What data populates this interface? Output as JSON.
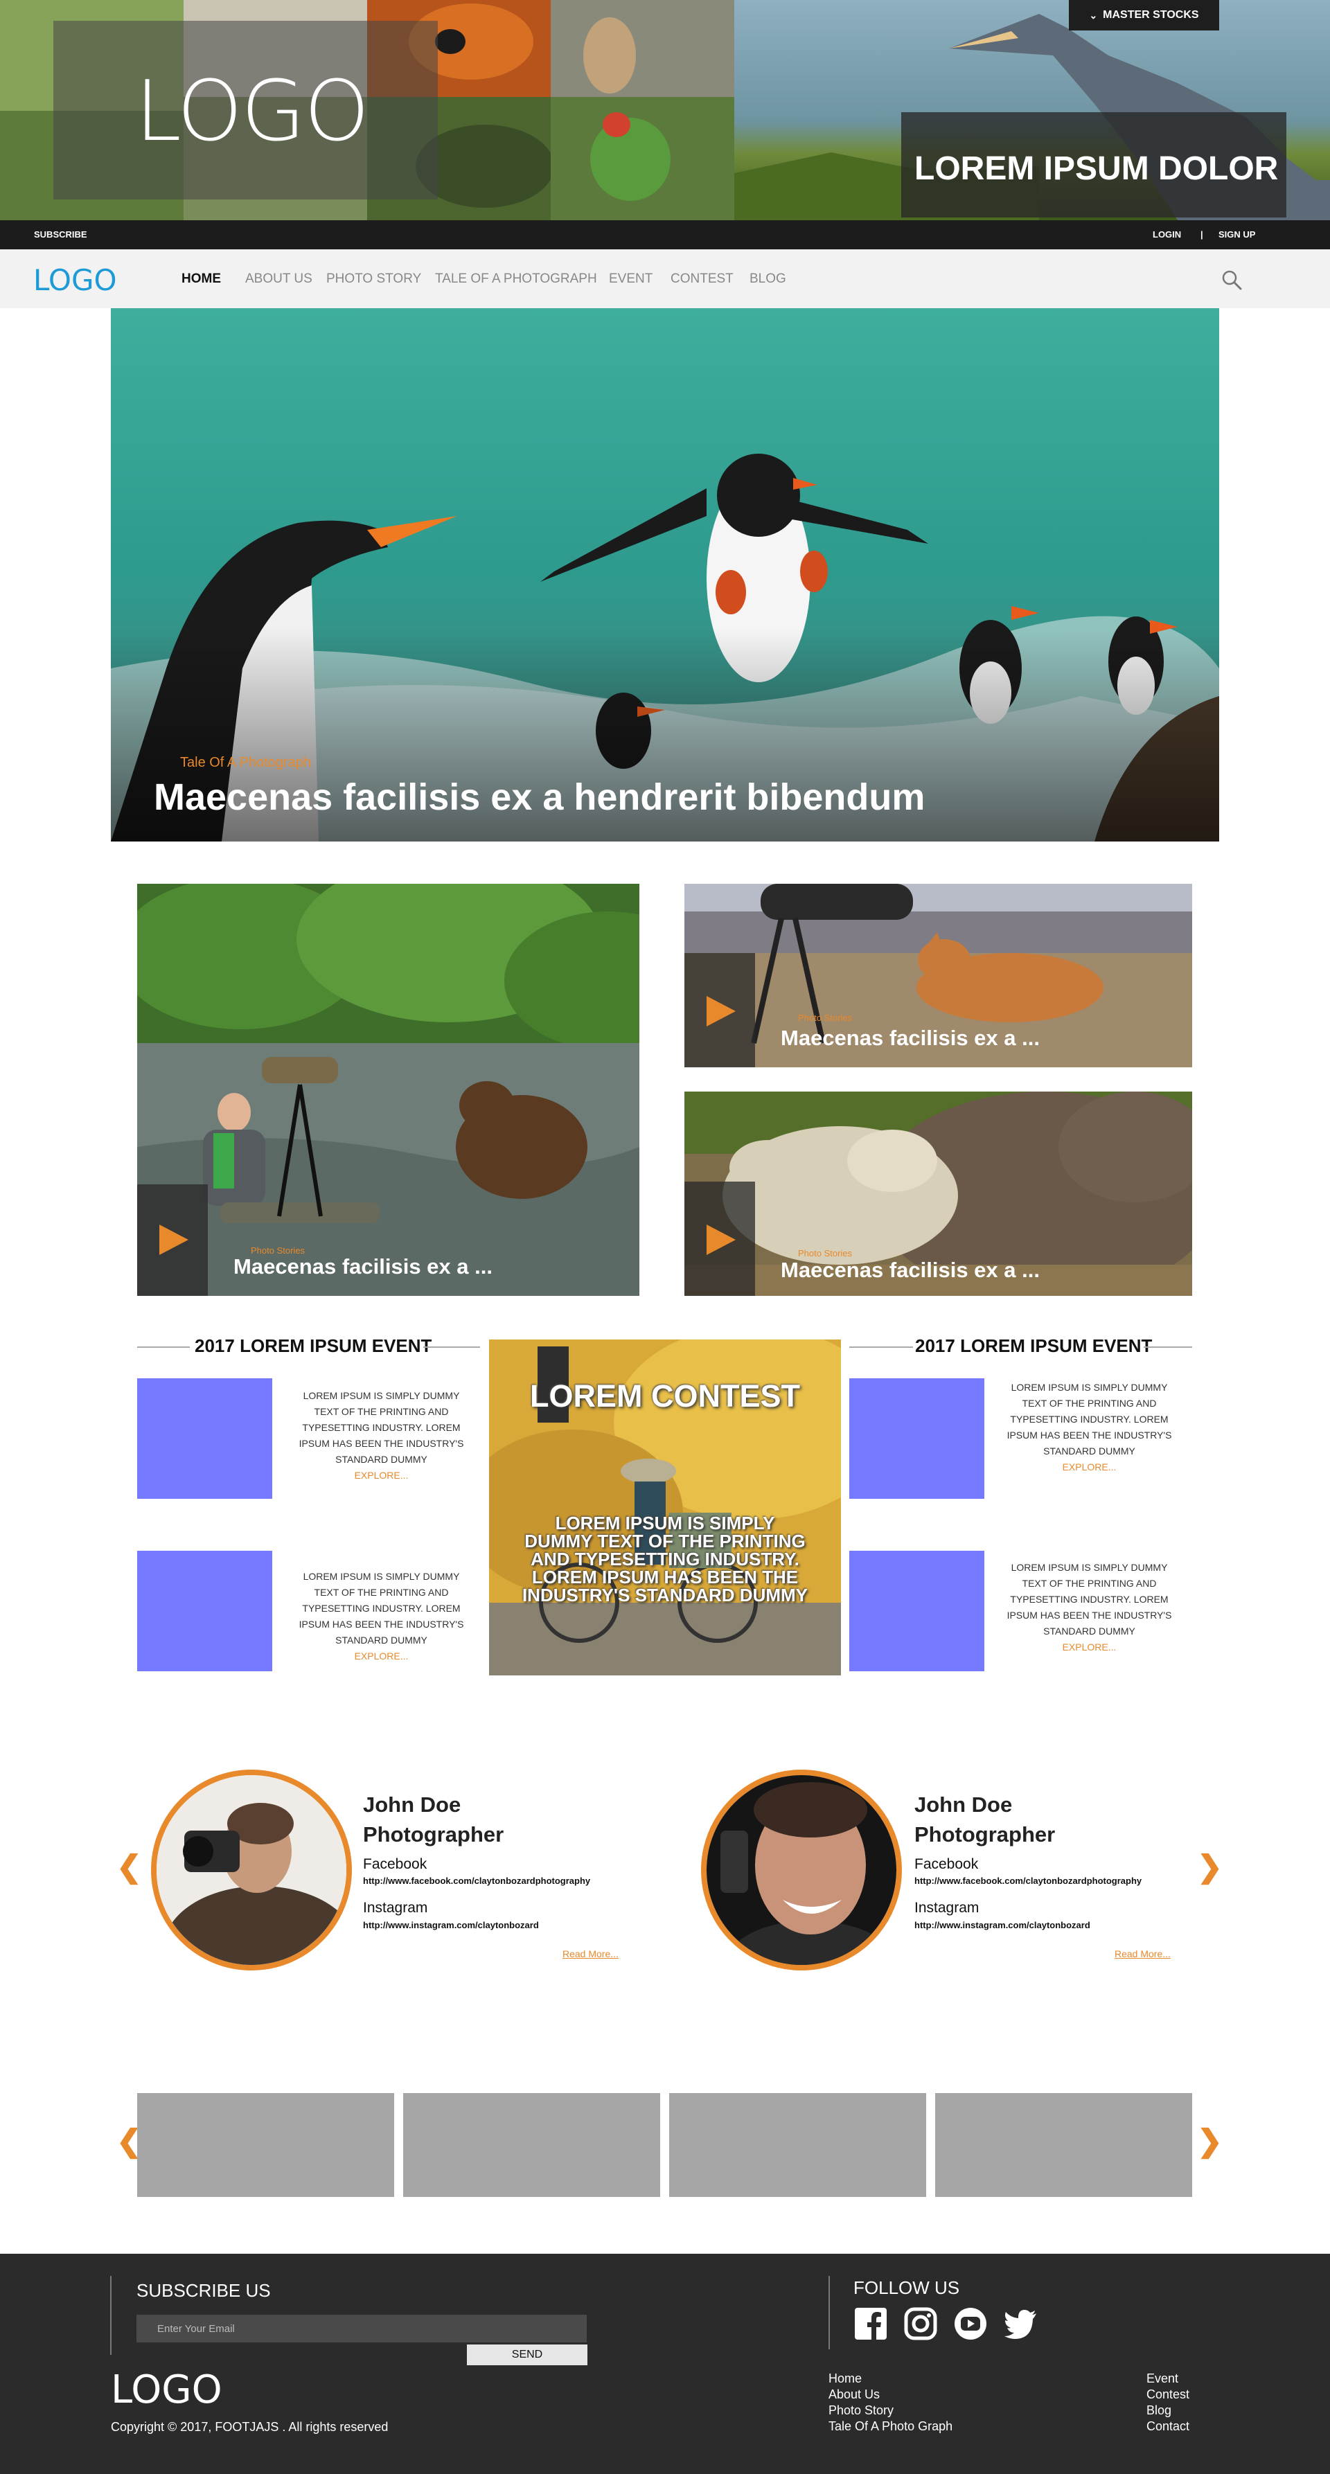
{
  "hero": {
    "logo": "LOGO",
    "master_stocks": "MASTER STOCKS",
    "tagline": "LOREM IPSUM DOLOR"
  },
  "topbar": {
    "subscribe": "SUBSCRIBE",
    "login": "LOGIN",
    "separator": "|",
    "signup": "SIGN UP"
  },
  "nav": {
    "logo": "LOGO",
    "items": [
      "HOME",
      "ABOUT US",
      "PHOTO STORY",
      "TALE OF A PHOTOGRAPH",
      "EVENT",
      "CONTEST",
      "BLOG"
    ],
    "active": "HOME"
  },
  "feature": {
    "category": "Tale Of A Photograph",
    "title": "Maecenas facilisis ex a hendrerit bibendum"
  },
  "cards": [
    {
      "category": "Photo Stories",
      "title": "Maecenas facilisis ex a ..."
    },
    {
      "category": "Photo Stories",
      "title": "Maecenas facilisis ex a ..."
    },
    {
      "category": "Photo Stories",
      "title": "Maecenas facilisis ex a ..."
    }
  ],
  "events": {
    "left_heading": "2017 LOREM IPSUM EVENT",
    "right_heading": "2017 LOREM IPSUM EVENT",
    "text": "LOREM IPSUM IS SIMPLY DUMMY TEXT OF THE PRINTING AND TYPESETTING INDUSTRY. LOREM IPSUM HAS BEEN THE INDUSTRY'S STANDARD DUMMY",
    "explore": "EXPLORE...",
    "contest_title": "LOREM CONTEST",
    "contest_text": "LOREM IPSUM IS SIMPLY DUMMY TEXT OF THE PRINTING AND TYPESETTING INDUSTRY. LOREM IPSUM HAS BEEN THE INDUSTRY'S STANDARD DUMMY"
  },
  "photographers": [
    {
      "name": "John Doe",
      "role": "Photographer",
      "facebook_label": "Facebook",
      "facebook_url": "http://www.facebook.com/claytonbozardphotography",
      "instagram_label": "Instagram",
      "instagram_url": "http://www.instagram.com/claytonbozard",
      "read_more": "Read More..."
    },
    {
      "name": "John Doe",
      "role": "Photographer",
      "facebook_label": "Facebook",
      "facebook_url": "http://www.facebook.com/claytonbozardphotography",
      "instagram_label": "Instagram",
      "instagram_url": "http://www.instagram.com/claytonbozard",
      "read_more": "Read More..."
    }
  ],
  "arrows": {
    "prev": "❮",
    "next": "❯"
  },
  "footer": {
    "subscribe_title": "SUBSCRIBE US",
    "email_placeholder": "Enter Your Email",
    "send": "SEND",
    "logo": "LOGO",
    "copyright": "Copyright © 2017, FOOTJAJS . All rights reserved",
    "follow_title": "FOLLOW US",
    "social_icons": [
      "facebook-icon",
      "instagram-icon",
      "youtube-icon",
      "twitter-icon"
    ],
    "links_left": [
      "Home",
      "About Us",
      "Photo Story",
      "Tale Of A Photo Graph"
    ],
    "links_right": [
      "Event",
      "Contest",
      "Blog",
      "Contact"
    ]
  },
  "colors": {
    "accent": "#e8892b",
    "logo_blue": "#1e9ad6",
    "event_placeholder": "#7579ff",
    "gallery_placeholder": "#a6a6a6",
    "footer_bg": "#2b2b2b"
  }
}
